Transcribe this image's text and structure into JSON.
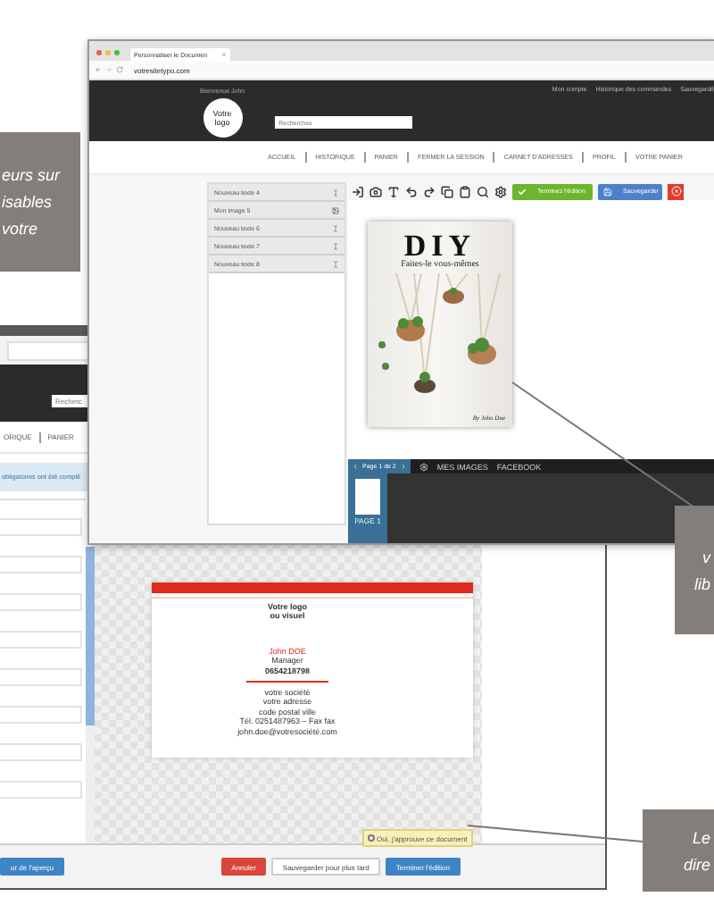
{
  "callouts": [
    {
      "lines": [
        "eurs sur",
        "isables",
        "votre"
      ]
    },
    {
      "lines": [
        "v",
        "lib"
      ]
    },
    {
      "lines": [
        "Le",
        "dire"
      ]
    }
  ],
  "back_window": {
    "search": {
      "placeholder": "Recherc"
    },
    "nav": [
      "ORIQUE",
      "PANIER"
    ],
    "notice": "obligatoires ont été complé",
    "card": {
      "logo_lines": [
        "Votre logo",
        "ou visuel"
      ],
      "name": "John DOE",
      "role": "Manager",
      "phone": "0654218798",
      "address_lines": [
        "votre société",
        "votre adresse",
        "code postal ville",
        "Tél. 0251487963 – Fax fax",
        "john.doe@votresociété.com"
      ]
    },
    "approval": {
      "label": "Oui, j'approuve ce document",
      "checked": false
    },
    "buttons": [
      {
        "label": "ur de l'aperçu",
        "kind": "primary"
      },
      {
        "label": "Annuler",
        "kind": "danger"
      },
      {
        "label": "Sauvegarder pour plus tard",
        "kind": "default"
      },
      {
        "label": "Terminer l'édition",
        "kind": "primary"
      }
    ]
  },
  "front_window": {
    "tab_title": "Personnaliser le Documen",
    "url": "votresitetypo.com",
    "greeting": "Bienvenue John",
    "logo_lines": [
      "Votre",
      "logo"
    ],
    "search": {
      "placeholder": "Recherches"
    },
    "account_links": [
      "Mon compte",
      "Historique des commandes",
      "Sauvegardé"
    ],
    "nav": [
      "ACCUEIL",
      "HISTORIQUE",
      "PANIER",
      "FERMER LA SESSION",
      "CARNET D'ADRESSES",
      "PROFIL",
      "VOTRE PANIER"
    ],
    "layers": [
      {
        "label": "Nouveau texte 4",
        "kind": "text"
      },
      {
        "label": "Mon image 5",
        "kind": "image"
      },
      {
        "label": "Nouveau texte 6",
        "kind": "text"
      },
      {
        "label": "Nouveau texte 7",
        "kind": "text"
      },
      {
        "label": "Nouveau texte 8",
        "kind": "text"
      }
    ],
    "toolbar_buttons": [
      {
        "label": "Terminez l'édition",
        "kind": "finish"
      },
      {
        "label": "Sauvegarder",
        "kind": "save"
      }
    ],
    "cover": {
      "title": "DIY",
      "subtitle": "Faites-le vous-mêmes",
      "author": "By John Doe"
    },
    "pages_panel": {
      "page_label": "Page 1 de 2",
      "tabs": [
        "MES IMAGES",
        "FACEBOOK"
      ],
      "thumbnails": [
        {
          "label": "PAGE 1",
          "selected": true
        }
      ]
    }
  }
}
